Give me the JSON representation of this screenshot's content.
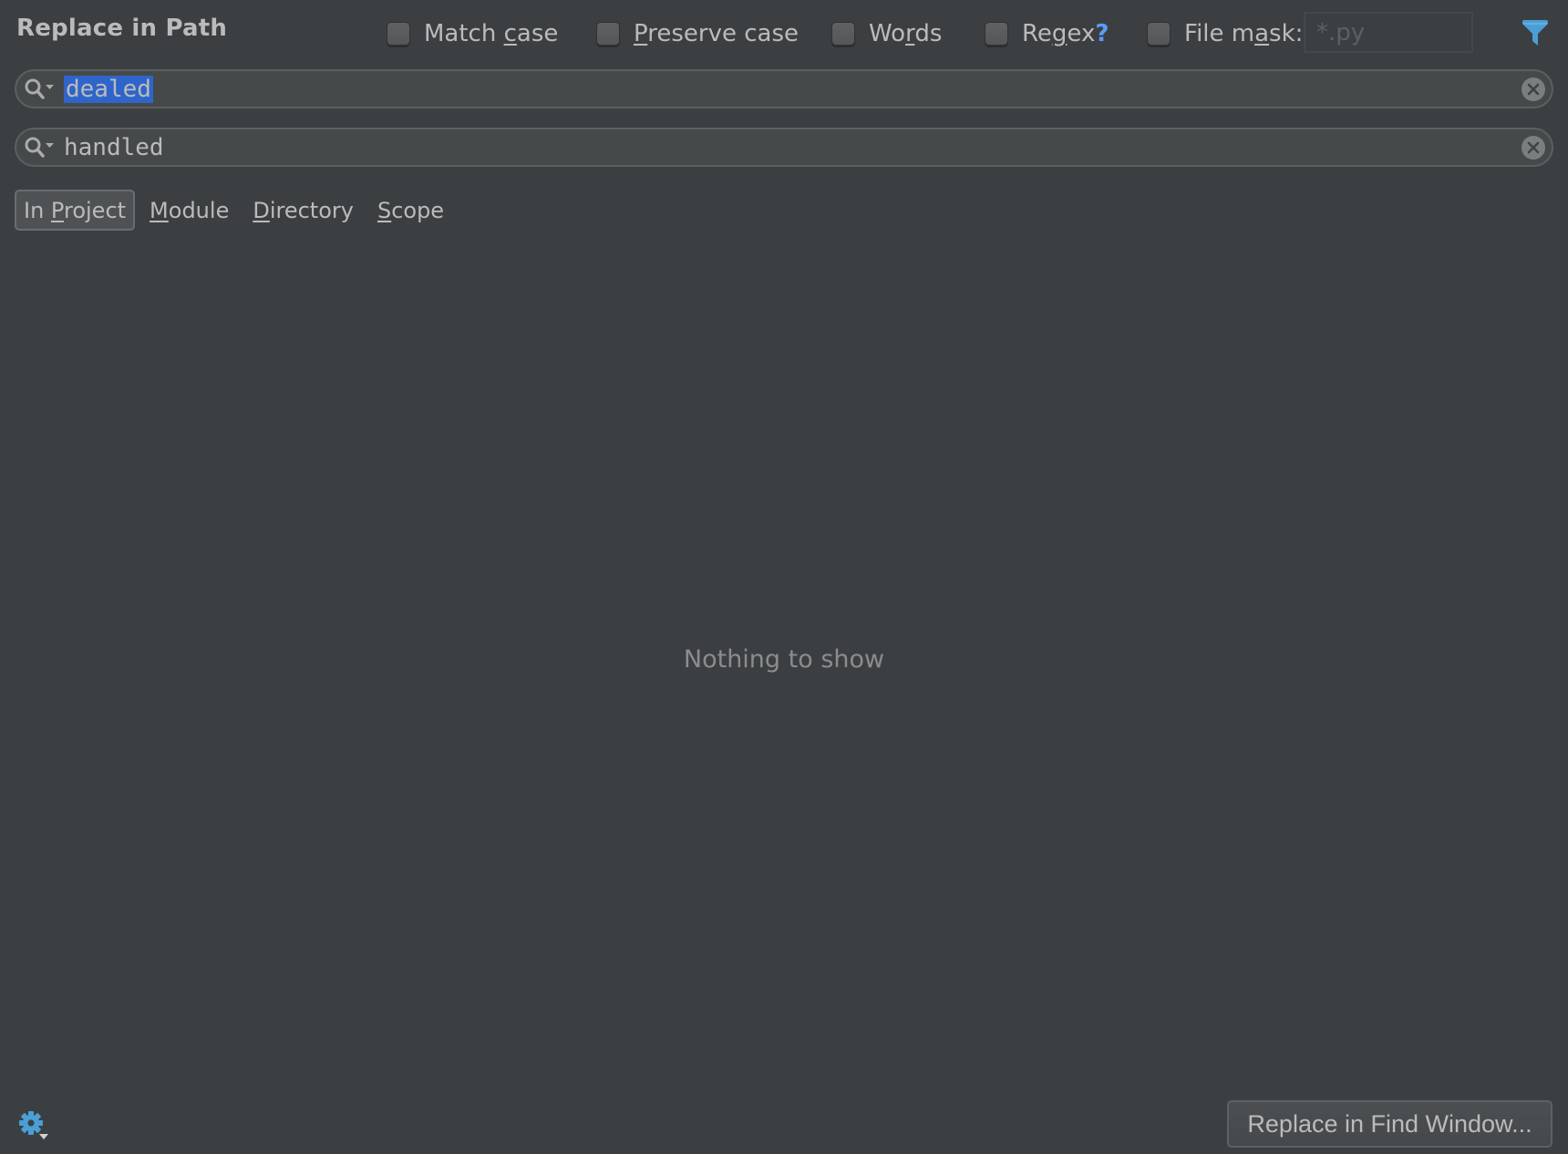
{
  "dialog": {
    "title": "Replace in Path"
  },
  "options": {
    "match_case": {
      "pre": "Match ",
      "mnemonic": "c",
      "post": "ase",
      "checked": false
    },
    "preserve_case": {
      "pre": "",
      "mnemonic": "P",
      "post": "reserve case",
      "checked": false
    },
    "words": {
      "pre": "Wo",
      "mnemonic": "r",
      "post": "ds",
      "checked": false
    },
    "regex": {
      "pre": "Re",
      "mnemonic": "g",
      "post": "ex",
      "help": "?",
      "checked": false
    },
    "file_mask": {
      "pre": "File m",
      "mnemonic": "a",
      "post": "sk:",
      "checked": false,
      "value": "",
      "placeholder": "*.py"
    }
  },
  "icons": {
    "filter": "filter-icon",
    "search": "search-history-icon",
    "clear": "clear-icon",
    "settings": "gear-icon"
  },
  "colors": {
    "background": "#3c3f42",
    "accent": "#4a9fd6",
    "selection": "#2f65ca",
    "help_link": "#589df6"
  },
  "search": {
    "find_value": "dealed",
    "find_selected": true,
    "replace_value": "handled"
  },
  "scope": {
    "tabs": [
      {
        "pre": "In ",
        "mnemonic": "P",
        "post": "roject",
        "active": true
      },
      {
        "pre": "",
        "mnemonic": "M",
        "post": "odule",
        "active": false
      },
      {
        "pre": "",
        "mnemonic": "D",
        "post": "irectory",
        "active": false
      },
      {
        "pre": "",
        "mnemonic": "S",
        "post": "cope",
        "active": false
      }
    ]
  },
  "results": {
    "empty_text": "Nothing to show"
  },
  "footer": {
    "replace_button": "Replace in Find Window..."
  }
}
